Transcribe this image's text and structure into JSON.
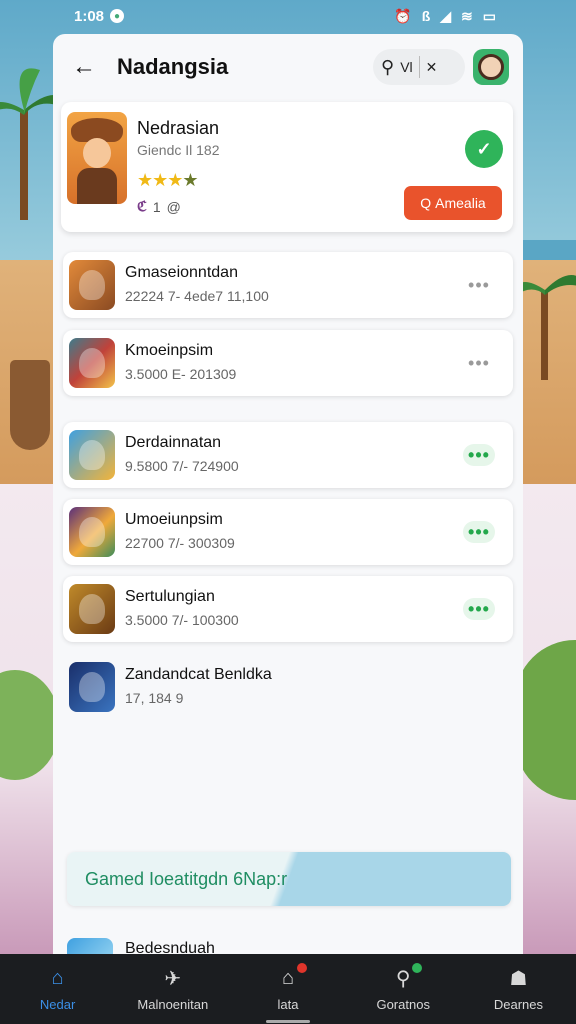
{
  "status_bar": {
    "time": "1:08",
    "icons_left": [
      "notification-icon"
    ],
    "icons_right": [
      "alarm-icon",
      "signal-icon",
      "wifi-icon",
      "battery-icon"
    ],
    "network_label": "ß"
  },
  "header": {
    "title": "Nadangsia",
    "search_label": "Vl",
    "close_label": "✕"
  },
  "featured": {
    "name": "Nedrasian",
    "subtitle": "Giendc Il 182",
    "stars_filled": "★★★",
    "star_dim": "★",
    "meta_icon": "ℭ",
    "meta_count": "1",
    "meta_extra": "@",
    "cta_label": "Amealia",
    "cta_icon": "Q"
  },
  "list": [
    {
      "name": "Gmaseionntdan",
      "sub": "22224 7- 4ede7 11,100",
      "more_style": "gray"
    },
    {
      "name": "Kmoeinpsim",
      "sub": "3.5000 E- 201309",
      "more_style": "gray"
    },
    {
      "name": "Derdainnatan",
      "sub": "9.5800 7/- 724900",
      "more_style": "green"
    },
    {
      "name": "Umoeiunpsim",
      "sub": "22700 7/- 300309",
      "more_style": "green"
    },
    {
      "name": "Sertulungian",
      "sub": "3.5000 7/- 100300",
      "more_style": "green"
    },
    {
      "name": "Zandandcat Benldka",
      "sub": "17, 184 9",
      "more_style": "none"
    }
  ],
  "more_dots": "•••",
  "promo": {
    "text": "Gamed Ioeatitgdn 6Nap:r"
  },
  "partial_row": {
    "text": "Bedesnduah"
  },
  "nav": [
    {
      "label": "Nedar",
      "icon": "home-icon",
      "active": true
    },
    {
      "label": "Malnoenitan",
      "icon": "controller-icon",
      "active": false
    },
    {
      "label": "lata",
      "icon": "store-icon",
      "active": false,
      "badge": "#e0352b"
    },
    {
      "label": "Goratnos",
      "icon": "search-icon",
      "active": false,
      "badge": "#2fb45a"
    },
    {
      "label": "Dearnes",
      "icon": "profile-icon",
      "active": false
    }
  ],
  "colors": {
    "accent": "#e9532c",
    "success": "#2fb45a",
    "nav_active": "#3b8fe6"
  }
}
